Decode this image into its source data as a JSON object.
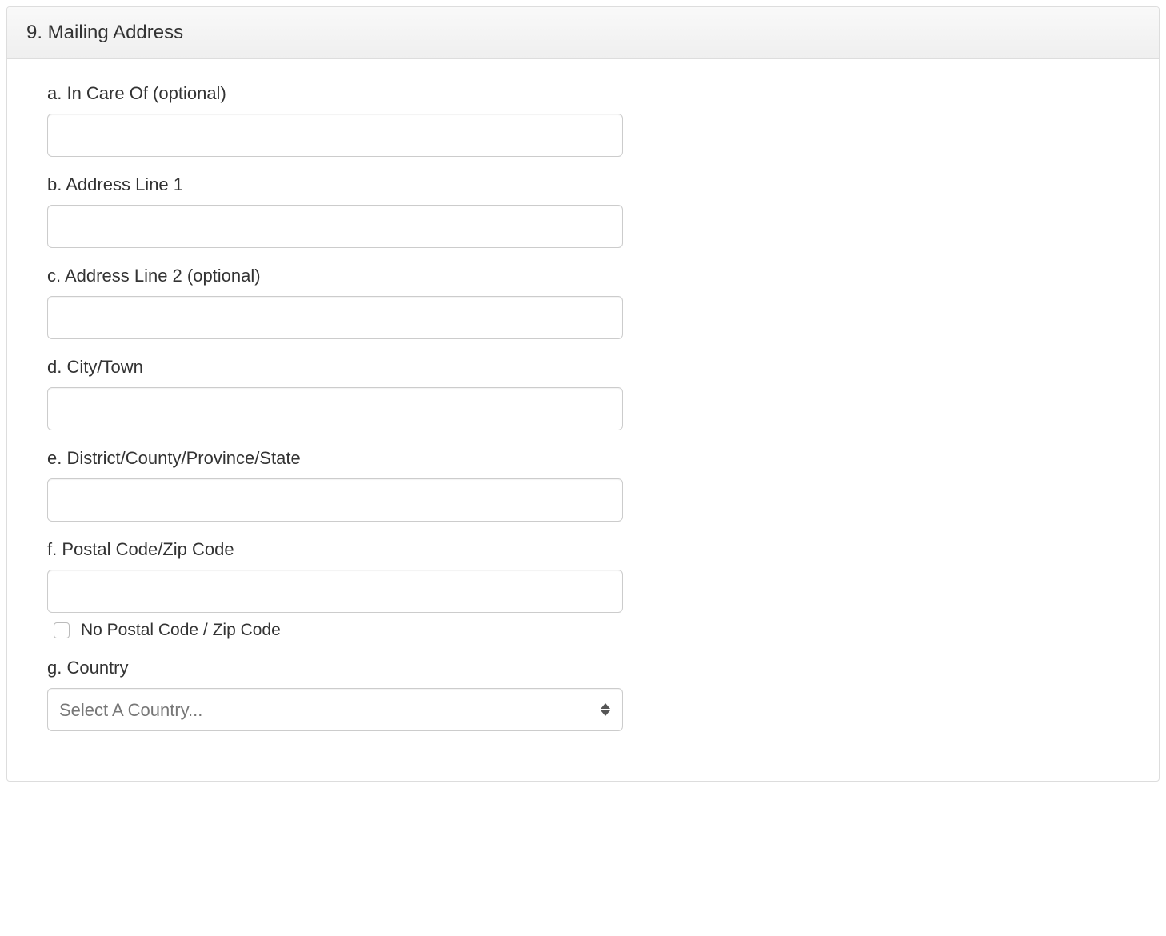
{
  "panel": {
    "title": "9. Mailing Address"
  },
  "fields": {
    "in_care_of": {
      "label": "a. In Care Of (optional)",
      "value": ""
    },
    "address_line_1": {
      "label": "b. Address Line 1",
      "value": ""
    },
    "address_line_2": {
      "label": "c. Address Line 2 (optional)",
      "value": ""
    },
    "city_town": {
      "label": "d. City/Town",
      "value": ""
    },
    "district_state": {
      "label": "e. District/County/Province/State",
      "value": ""
    },
    "postal_code": {
      "label": "f. Postal Code/Zip Code",
      "value": ""
    },
    "no_postal_code": {
      "label": "No Postal Code / Zip Code",
      "checked": false
    },
    "country": {
      "label": "g. Country",
      "selected": "Select A Country..."
    }
  }
}
